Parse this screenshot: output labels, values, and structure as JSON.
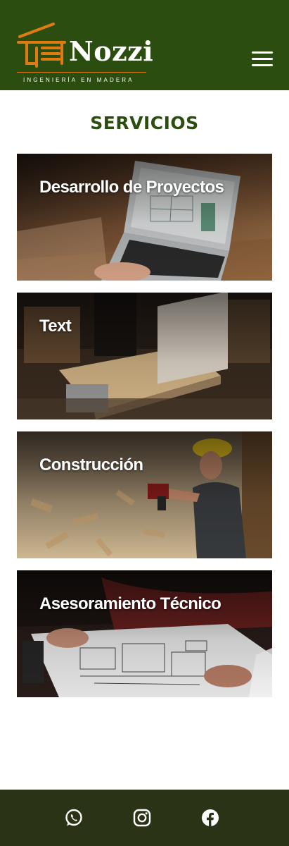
{
  "brand": {
    "name": "Nozzi",
    "tagline": "INGENIERÍA EN MADERA",
    "colors": {
      "primary": "#2b4d0f",
      "accent": "#e07b14",
      "footer": "#2a3315"
    }
  },
  "header": {
    "menu_icon": "hamburger-menu-icon"
  },
  "services": {
    "title": "SERVICIOS",
    "cards": [
      {
        "label": "Desarrollo de Proyectos"
      },
      {
        "label": "Text"
      },
      {
        "label": "Construcción"
      },
      {
        "label": "Asesoramiento Técnico"
      }
    ]
  },
  "footer": {
    "icons": [
      "whatsapp-icon",
      "instagram-icon",
      "facebook-icon"
    ]
  }
}
